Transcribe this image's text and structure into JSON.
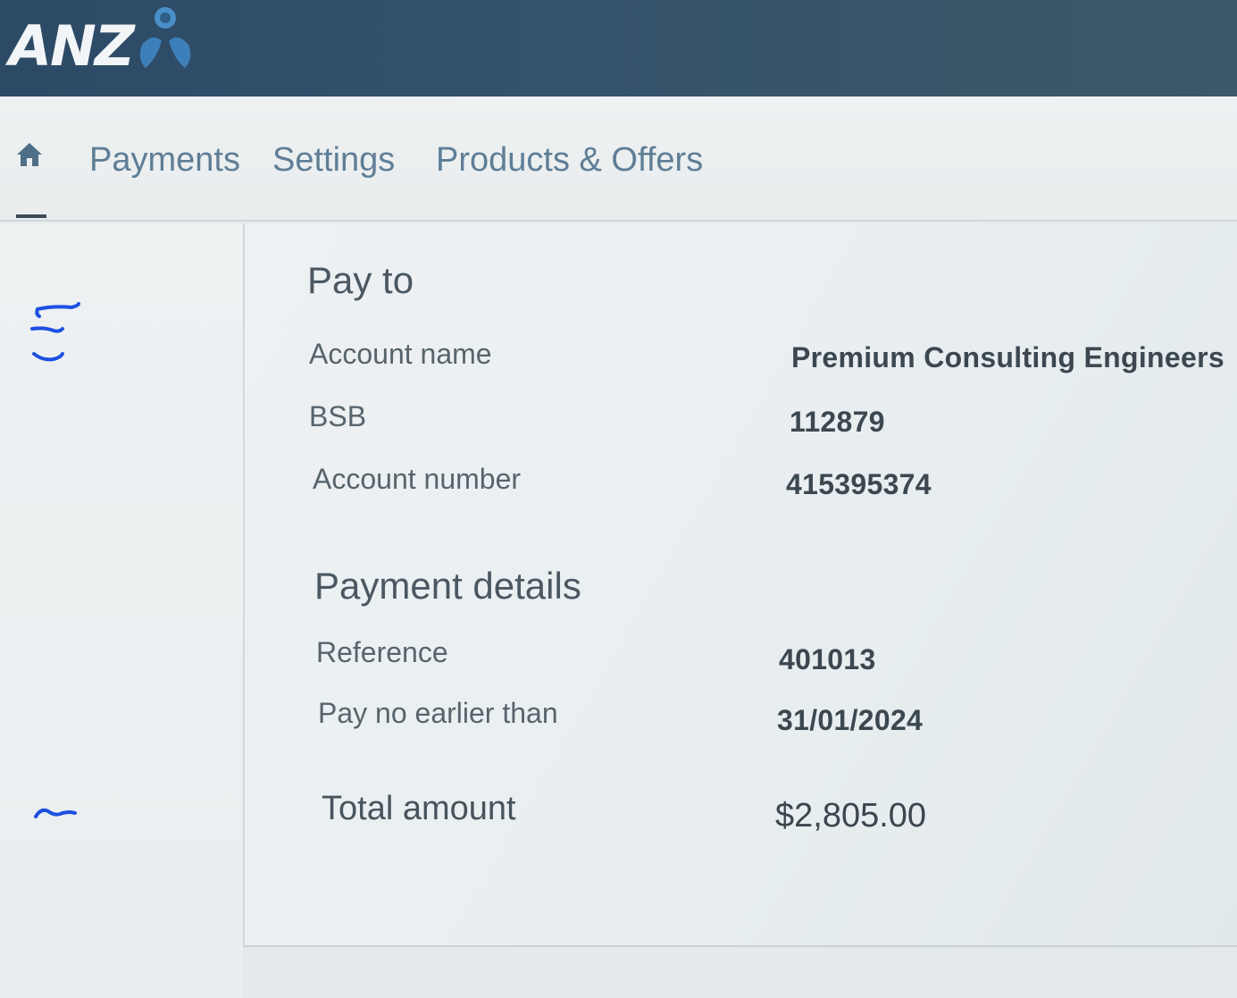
{
  "brand": {
    "logo_text": "ANZ",
    "colors": {
      "header_bg": "#2c4a66",
      "nav_text": "#5f7e96",
      "logo_mark": "#4a8fc9"
    }
  },
  "nav": {
    "home_icon": "home-icon",
    "items": [
      {
        "label": "Payments"
      },
      {
        "label": "Settings"
      },
      {
        "label": "Products & Offers"
      }
    ]
  },
  "pay_to": {
    "title": "Pay to",
    "account_name_label": "Account name",
    "account_name_value": "Premium Consulting Engineers",
    "bsb_label": "BSB",
    "bsb_value": "112879",
    "account_number_label": "Account number",
    "account_number_value": "415395374"
  },
  "payment_details": {
    "title": "Payment details",
    "reference_label": "Reference",
    "reference_value": "401013",
    "pay_date_label": "Pay no earlier than",
    "pay_date_value": "31/01/2024"
  },
  "total": {
    "label": "Total amount",
    "value": "$2,805.00"
  }
}
